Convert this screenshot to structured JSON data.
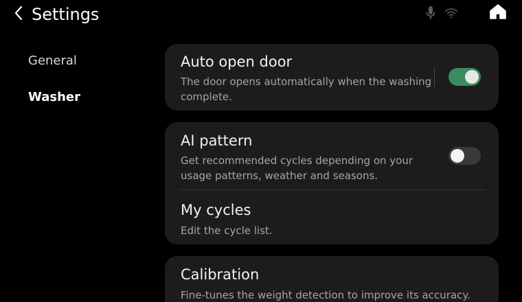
{
  "header": {
    "title": "Settings",
    "back_icon": "chevron-left-icon",
    "status_icons": [
      "microphone-icon",
      "wifi-icon"
    ],
    "home_icon": "home-icon"
  },
  "sidebar": {
    "items": [
      {
        "label": "General",
        "selected": false
      },
      {
        "label": "Washer",
        "selected": true
      }
    ]
  },
  "settings": {
    "auto_open_door": {
      "title": "Auto open door",
      "description": "The door opens automatically when the washing complete.",
      "enabled": true
    },
    "ai_pattern": {
      "title": "AI pattern",
      "description": "Get recommended cycles depending on your usage patterns, weather and seasons.",
      "enabled": false
    },
    "my_cycles": {
      "title": "My cycles",
      "description": "Edit the cycle list."
    },
    "calibration": {
      "title": "Calibration",
      "description": "Fine-tunes the weight detection to improve its accuracy."
    }
  },
  "colors": {
    "background": "#000000",
    "card": "#1c1c1c",
    "toggle_on": "#3c8c5e",
    "toggle_off": "#3a3a3a",
    "secondary_text": "#a6a6a6"
  }
}
